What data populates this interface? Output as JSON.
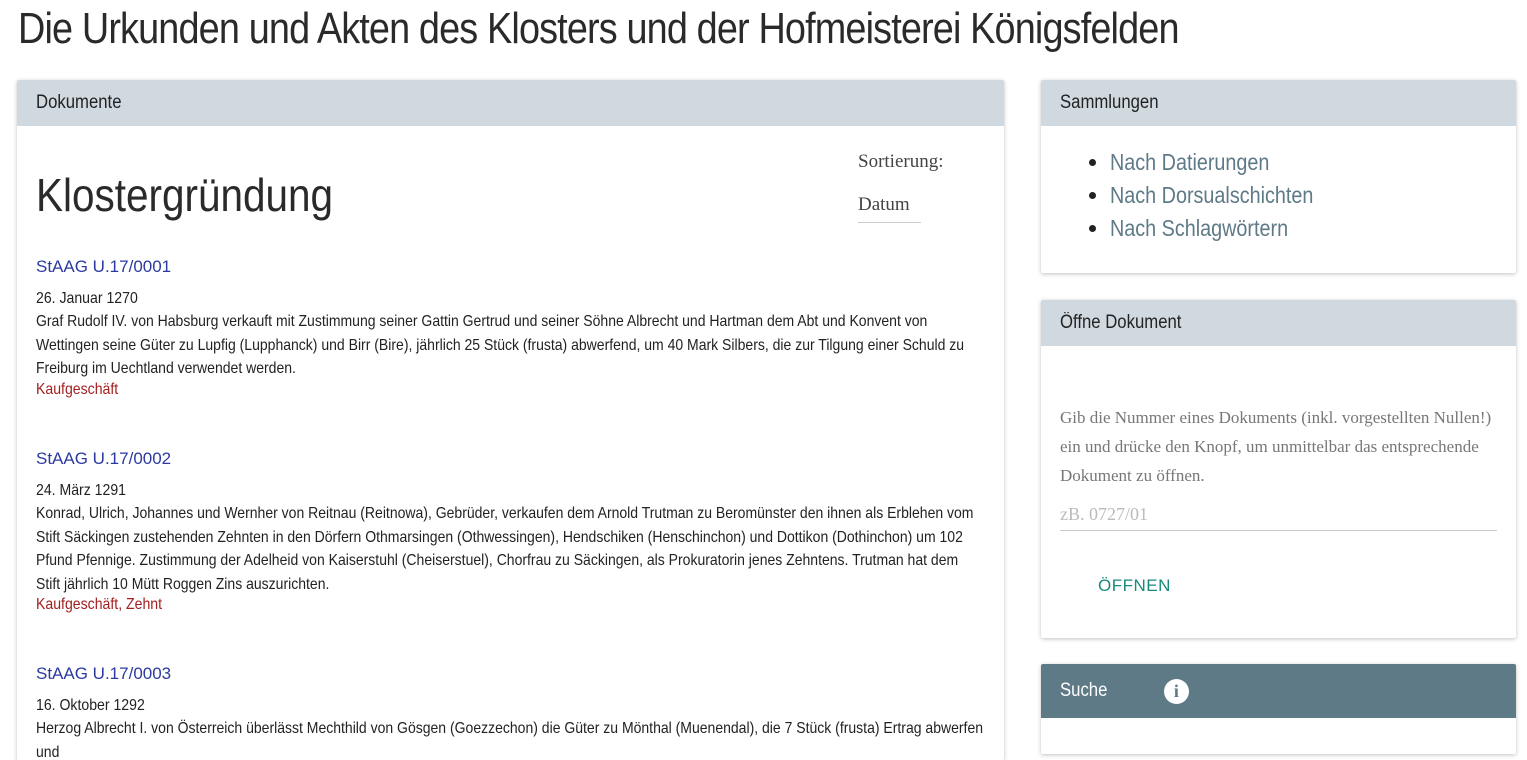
{
  "page": {
    "title": "Die Urkunden und Akten des Klosters und der Hofmeisterei Königsfelden"
  },
  "documents_card": {
    "header": "Dokumente",
    "section_title": "Klostergründung",
    "sort_label": "Sortierung:",
    "sort_value": "Datum",
    "entries": [
      {
        "signature": "StAAG U.17/0001",
        "date": "26. Januar 1270",
        "description": "Graf Rudolf IV. von Habsburg verkauft mit Zustimmung seiner Gattin Gertrud und seiner Söhne Albrecht und Hartman dem Abt und Konvent von Wettingen seine Güter zu Lupfig (Lupphanck) und Birr (Bire), jährlich 25 Stück (frusta) abwerfend, um 40 Mark Silbers, die zur Tilgung einer Schuld zu Freiburg im Uechtland verwendet werden.",
        "tags": "Kaufgeschäft"
      },
      {
        "signature": "StAAG U.17/0002",
        "date": "24. März 1291",
        "description": "Konrad, Ulrich, Johannes und Wernher von Reitnau (Reitnowa), Gebrüder, verkaufen dem Arnold Trutman zu Beromünster den ihnen als Erblehen vom Stift Säckingen zustehenden Zehnten in den Dörfern Othmarsingen (Othwessingen), Hendschiken (Henschinchon) und Dottikon (Dothinchon) um 102 Pfund Pfennige. Zustimmung der Adelheid von Kaiserstuhl (Cheiserstuel), Chorfrau zu Säckingen, als Prokuratorin jenes Zehntens. Trutman hat dem Stift jährlich 10 Mütt Roggen Zins auszurichten.",
        "tags": "Kaufgeschäft, Zehnt"
      },
      {
        "signature": "StAAG U.17/0003",
        "date": "16. Oktober 1292",
        "description": "Herzog Albrecht I. von Österreich überlässt Mechthild von Gösgen (Goezzechon) die Güter zu Mönthal (Muenendal), die 7 Stück (frusta) Ertrag abwerfen und",
        "tags": ""
      }
    ]
  },
  "sammlungen_card": {
    "header": "Sammlungen",
    "links": [
      "Nach Datierungen",
      "Nach Dorsualschichten",
      "Nach Schlagwörtern"
    ]
  },
  "oeffne_card": {
    "header": "Öffne Dokument",
    "help_text": "Gib die Nummer eines Dokuments (inkl. vorgestellten Nullen!) ein und drücke den Knopf, um unmittelbar das entsprechende Dokument zu öffnen.",
    "input_placeholder": "zB. 0727/01",
    "input_value": "",
    "button_label": "ÖFFNEN"
  },
  "suche_card": {
    "header": "Suche",
    "info_icon": "info-icon",
    "info_glyph": "i"
  },
  "colors": {
    "card_header_bg": "#d0d9e0",
    "suche_header_bg": "#5e7a87",
    "signature_link": "#2b3aa0",
    "tag_text": "#a32020",
    "collection_link": "#5e7a87",
    "open_button": "#1a8a7a"
  }
}
